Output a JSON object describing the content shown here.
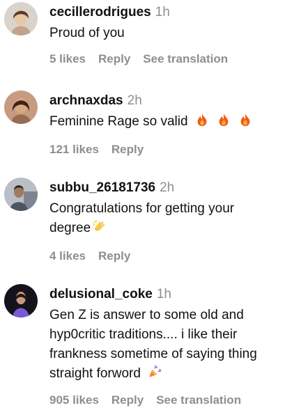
{
  "comments": [
    {
      "username": "cecillerodrigues",
      "time": "1h",
      "text": "Proud of you",
      "likes": "5 likes",
      "reply": "Reply",
      "see_translation": "See translation",
      "avatar_icon": "avatar-woman-icon"
    },
    {
      "username": "archnaxdas",
      "time": "2h",
      "text": "Feminine Rage so valid",
      "emoji": "fire-icon x3",
      "likes": "121 likes",
      "reply": "Reply",
      "avatar_icon": "avatar-woman-icon"
    },
    {
      "username": "subbu_26181736",
      "time": "2h",
      "text_line1": "Congratulations for getting your",
      "text_line2": "degree",
      "emoji": "clapping-hands-icon",
      "likes": "4 likes",
      "reply": "Reply",
      "avatar_icon": "avatar-man-icon"
    },
    {
      "username": "delusional_coke",
      "time": "1h",
      "text_line1": "Gen Z is answer to some old and",
      "text_line2": "hyp0critic traditions.... i like their",
      "text_line3": "frankness sometime of saying thing",
      "text_line4": "straight forword",
      "emoji": "party-popper-icon",
      "likes": "905 likes",
      "reply": "Reply",
      "see_translation": "See translation",
      "avatar_icon": "avatar-woman-icon"
    }
  ]
}
